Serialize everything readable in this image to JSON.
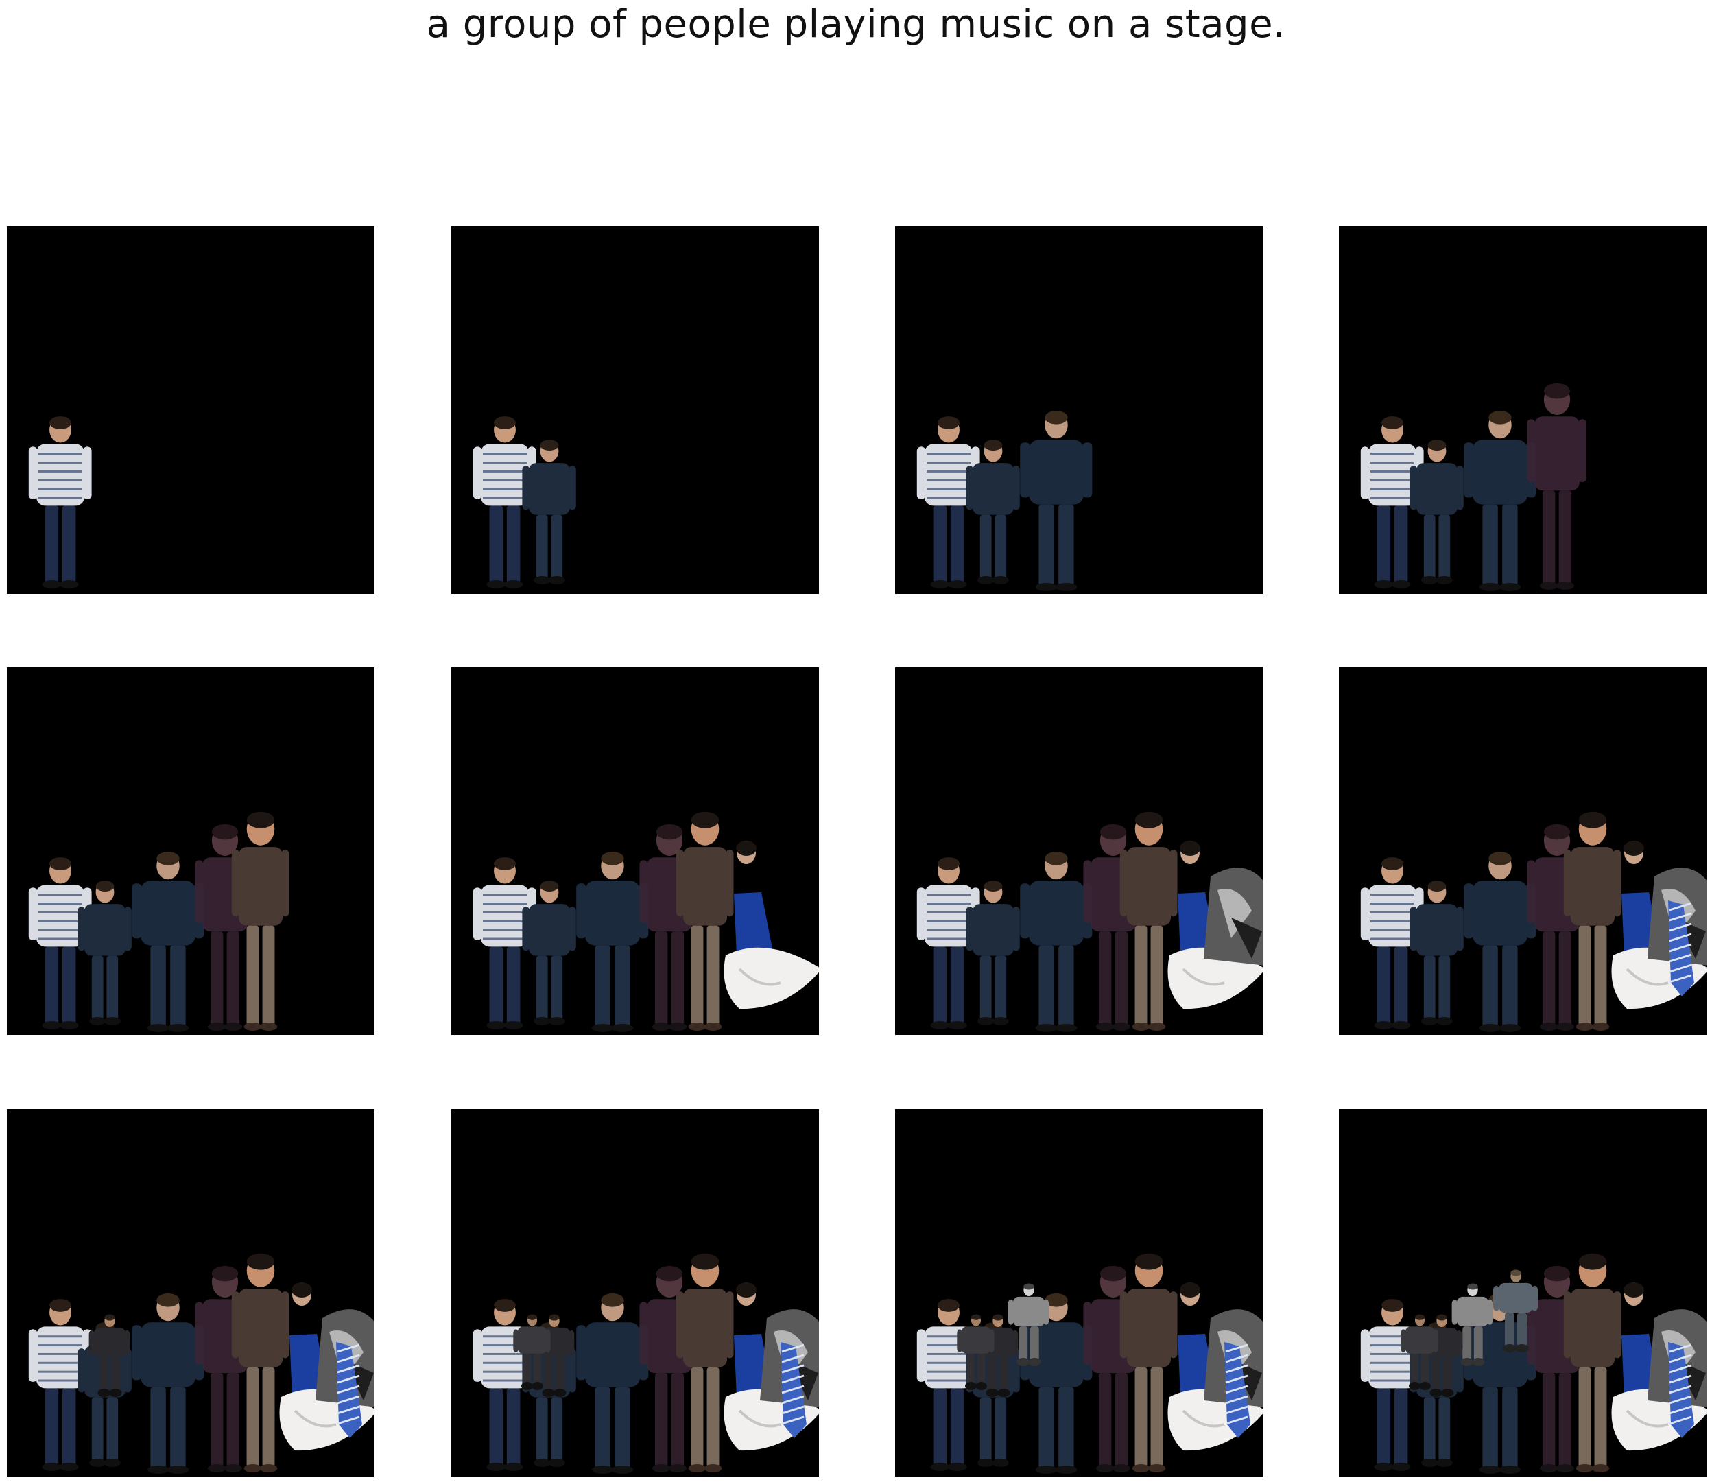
{
  "caption": "a group of people playing music on a stage.",
  "colors": {
    "figure_background": "#ffffff",
    "panel_background": "#000000"
  },
  "grid": {
    "rows": 3,
    "columns": 4
  },
  "panels": [
    {
      "index": 1,
      "visible_segments": [
        "man-striped-shirt"
      ]
    },
    {
      "index": 2,
      "visible_segments": [
        "man-striped-shirt",
        "boy-dark-jacket"
      ]
    },
    {
      "index": 3,
      "visible_segments": [
        "man-striped-shirt",
        "boy-dark-jacket",
        "man-navy-jacket"
      ]
    },
    {
      "index": 4,
      "visible_segments": [
        "man-striped-shirt",
        "boy-dark-jacket",
        "man-navy-jacket",
        "person-maroon-faded"
      ]
    },
    {
      "index": 5,
      "visible_segments": [
        "man-striped-shirt",
        "boy-dark-jacket",
        "man-navy-jacket",
        "person-maroon-faded",
        "man-leather-jacket"
      ]
    },
    {
      "index": 6,
      "visible_segments": [
        "man-striped-shirt",
        "boy-dark-jacket",
        "man-navy-jacket",
        "person-maroon-faded",
        "man-leather-jacket",
        "woman-white-dress"
      ]
    },
    {
      "index": 7,
      "visible_segments": [
        "man-striped-shirt",
        "boy-dark-jacket",
        "man-navy-jacket",
        "person-maroon-faded",
        "man-leather-jacket",
        "woman-white-dress",
        "grayscale-person-right"
      ]
    },
    {
      "index": 8,
      "visible_segments": [
        "man-striped-shirt",
        "boy-dark-jacket",
        "man-navy-jacket",
        "person-maroon-faded",
        "man-leather-jacket",
        "woman-white-dress",
        "grayscale-person-right",
        "blue-striped-tie"
      ]
    },
    {
      "index": 9,
      "visible_segments": [
        "man-striped-shirt",
        "boy-dark-jacket",
        "man-navy-jacket",
        "person-maroon-faded",
        "man-leather-jacket",
        "woman-white-dress",
        "grayscale-person-right",
        "blue-striped-tie",
        "man-dark-suit-small"
      ]
    },
    {
      "index": 10,
      "visible_segments": [
        "man-striped-shirt",
        "boy-dark-jacket",
        "man-navy-jacket",
        "person-maroon-faded",
        "man-leather-jacket",
        "woman-white-dress",
        "grayscale-person-right",
        "blue-striped-tie",
        "man-dark-suit-small",
        "man-dark-suit-second"
      ]
    },
    {
      "index": 11,
      "visible_segments": [
        "man-striped-shirt",
        "boy-dark-jacket",
        "man-navy-jacket",
        "person-maroon-faded",
        "man-leather-jacket",
        "woman-white-dress",
        "grayscale-person-right",
        "blue-striped-tie",
        "man-dark-suit-small",
        "man-dark-suit-second",
        "grayscale-child"
      ]
    },
    {
      "index": 12,
      "visible_segments": [
        "man-striped-shirt",
        "boy-dark-jacket",
        "man-navy-jacket",
        "person-maroon-faded",
        "man-leather-jacket",
        "woman-white-dress",
        "grayscale-person-right",
        "blue-striped-tie",
        "man-dark-suit-small",
        "man-dark-suit-second",
        "grayscale-child",
        "man-back-of-head"
      ]
    }
  ]
}
